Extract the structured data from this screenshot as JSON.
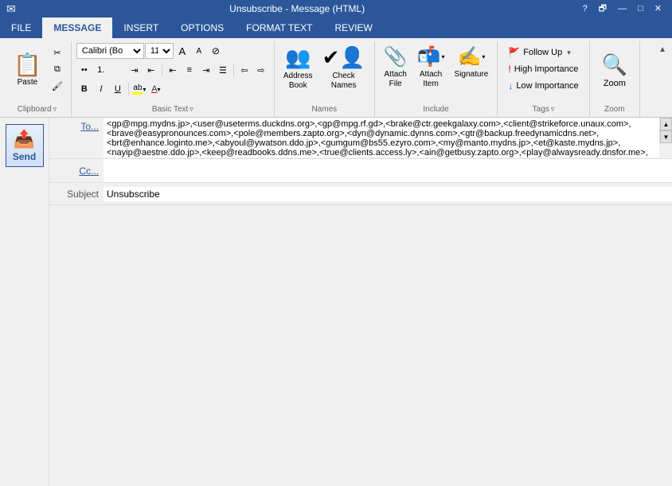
{
  "titleBar": {
    "title": "Unsubscribe - Message (HTML)",
    "helpBtn": "?",
    "restoreBtn": "🗗",
    "minimizeBtn": "—",
    "maximizeBtn": "□",
    "closeBtn": "✕"
  },
  "ribbonTabs": {
    "file": "FILE",
    "message": "MESSAGE",
    "insert": "INSERT",
    "options": "OPTIONS",
    "formatText": "FORMAT TEXT",
    "review": "REVIEW"
  },
  "groups": {
    "clipboard": {
      "label": "Clipboard",
      "paste": "Paste",
      "cut": "Cut",
      "copy": "Copy",
      "formatPainter": "Format Painter"
    },
    "basicText": {
      "label": "Basic Text",
      "font": "Calibri (Bo",
      "fontSize": "11",
      "bold": "B",
      "italic": "I",
      "underline": "U",
      "highlight": "ab",
      "fontColor": "A"
    },
    "names": {
      "label": "Names",
      "addressBook": "Address\nBook",
      "checkNames": "Check\nNames"
    },
    "include": {
      "label": "Include",
      "attachFile": "Attach\nFile",
      "attachItem": "Attach\nItem",
      "signature": "Signature"
    },
    "tags": {
      "label": "Tags",
      "followUp": "Follow Up",
      "highImportance": "High Importance",
      "lowImportance": "Low Importance"
    },
    "zoom": {
      "label": "Zoom",
      "zoom": "Zoom"
    }
  },
  "compose": {
    "toLabel": "To...",
    "ccLabel": "Cc...",
    "subjectLabel": "Subject",
    "toValue": "<gp@mpg.mydns.jp>,<user@useterms.duckdns.org>,<gp@mpg.rf.gd>,<brake@ctr.geekgalaxy.com>,<client@strikeforce.unaux.com>,<brave@easypronounces.com>,<pole@members.zapto.org>,<dyn@dynamic.dynns.com>,<gtr@backup.freedynamicdns.net>,<brt@enhance.loginto.me>,<abyoul@ywatson.ddo.jp>,<gumgum@bs55.ezyro.com>,<my@manto.mydns.jp>,<et@kaste.mydns.jp>,<nayip@aestne.ddo.jp>,<keep@readbooks.ddns.me>,<true@clients.access.ly>,<ain@getbusy.zapto.org>,<play@alwaysready.dnsfor.me>,<read@certi",
    "ccValue": "",
    "subjectValue": "Unsubscribe",
    "bodyValue": ""
  }
}
